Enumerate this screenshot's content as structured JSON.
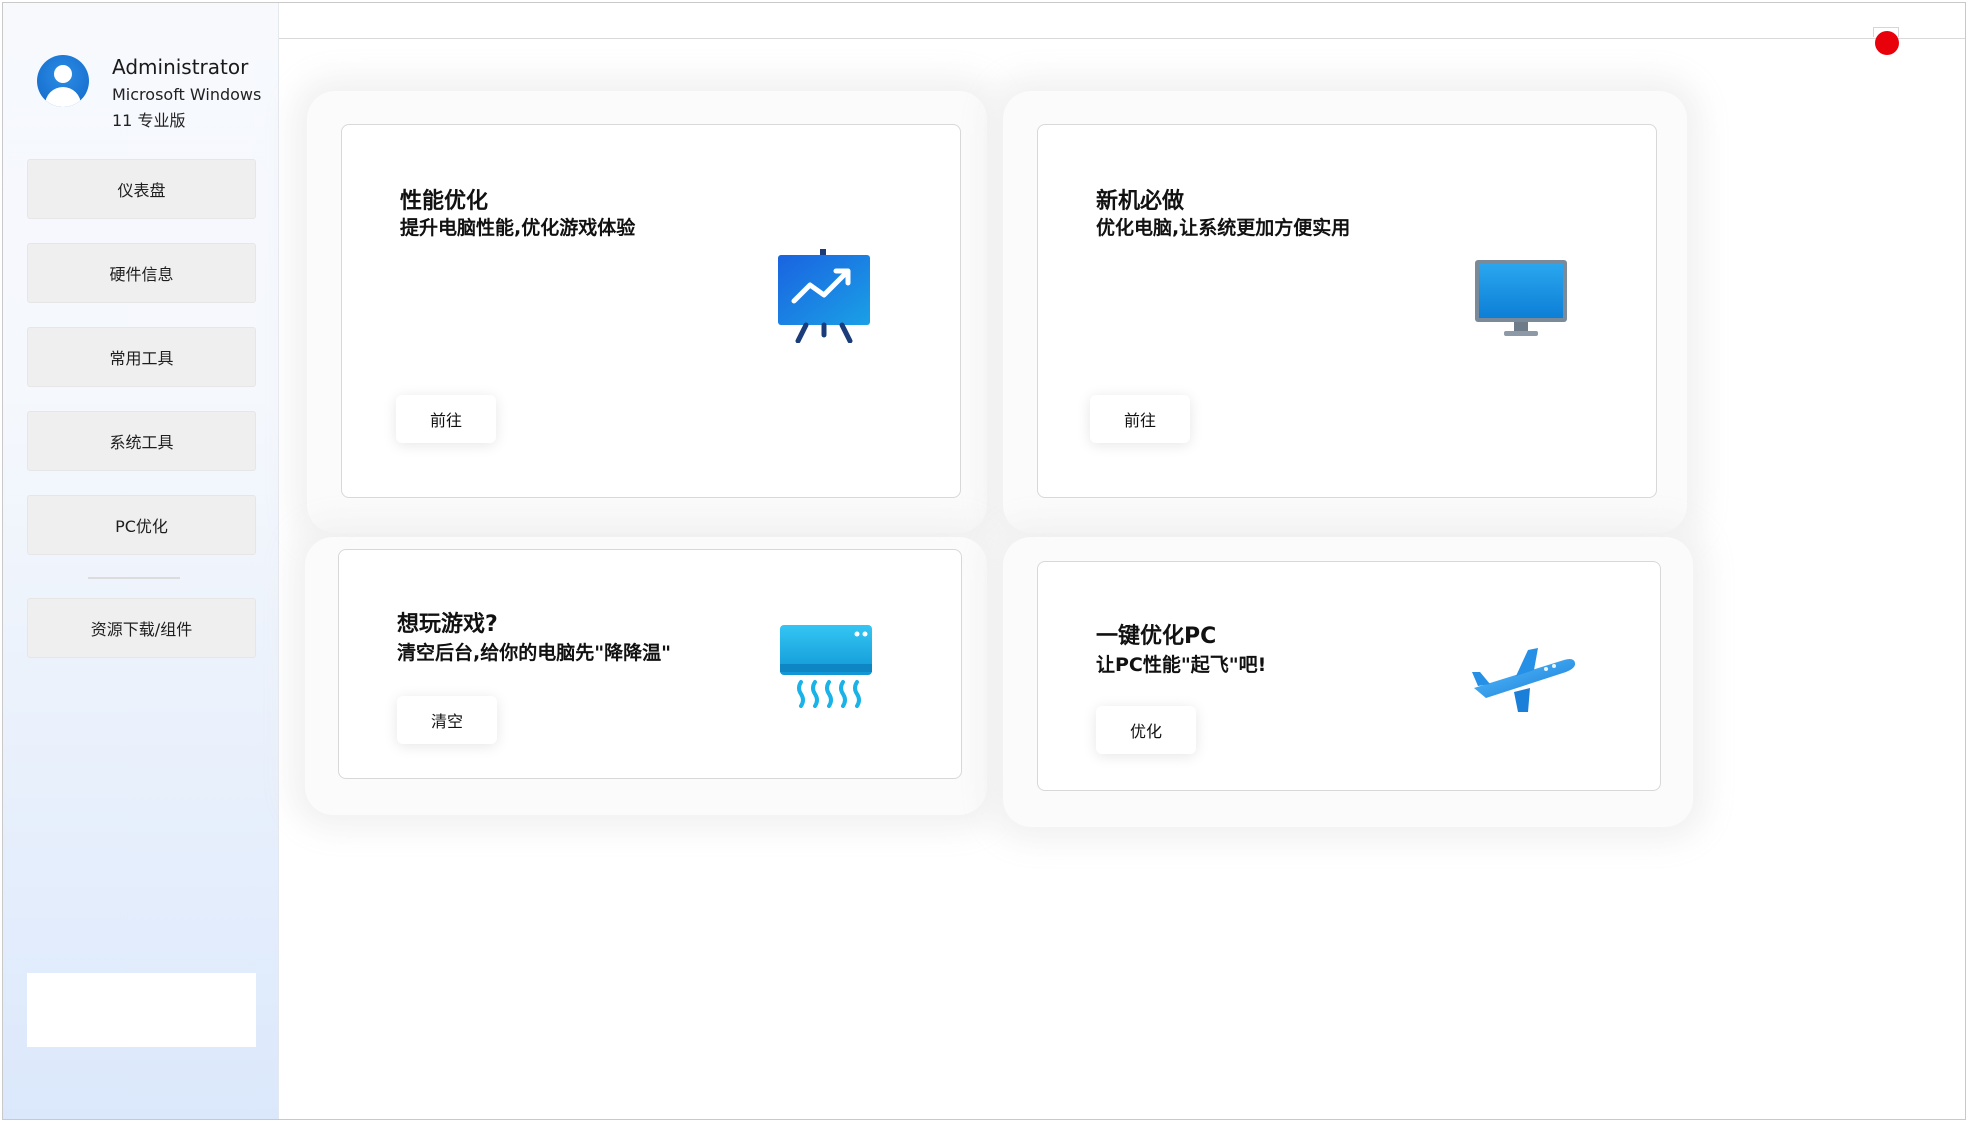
{
  "user": {
    "name": "Administrator",
    "os_line1": "Microsoft Windows",
    "os_line2": "11 专业版"
  },
  "sidebar": {
    "items": [
      {
        "label": "仪表盘"
      },
      {
        "label": "硬件信息"
      },
      {
        "label": "常用工具"
      },
      {
        "label": "系统工具"
      },
      {
        "label": "PC优化"
      }
    ],
    "resources_label": "资源下载/组件"
  },
  "cards": {
    "performance": {
      "title": "性能优化",
      "subtitle": "提升电脑性能,优化游戏体验",
      "button": "前往",
      "icon": "presentation-chart-icon"
    },
    "new_pc": {
      "title": "新机必做",
      "subtitle": "优化电脑,让系统更加方便实用",
      "button": "前往",
      "icon": "monitor-icon"
    },
    "gaming": {
      "title": "想玩游戏?",
      "subtitle": "清空后台,给你的电脑先\"降降温\"",
      "button": "清空",
      "icon": "air-conditioner-icon"
    },
    "one_click": {
      "title": "一键优化PC",
      "subtitle": "让PC性能\"起飞\"吧!",
      "button": "优化",
      "icon": "airplane-icon"
    }
  },
  "colors": {
    "accent_blue": "#1a73d9",
    "close_red": "#e8000b",
    "sidebar_gradient_end": "#dbe8fb"
  }
}
